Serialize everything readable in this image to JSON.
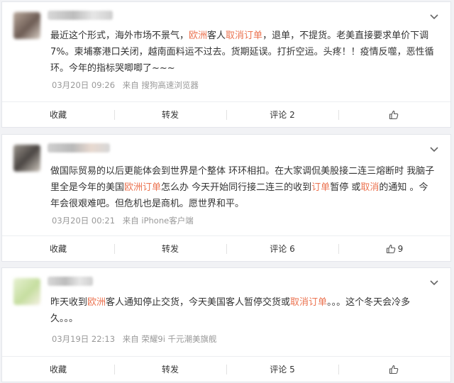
{
  "comments": [
    {
      "segments": [
        {
          "text": "最近这个形式，海外市场不景气，",
          "hl": false
        },
        {
          "text": "欧洲",
          "hl": true
        },
        {
          "text": "客人",
          "hl": false
        },
        {
          "text": "取消订单",
          "hl": true
        },
        {
          "text": "，退单，不提货。老美直接要求单价下调7%。柬埔寨港口关闭，越南面料运不过去。货期延误。打折空运。头疼！！疫情反噬，恶性循环。今年的指标哭唧唧了~~~",
          "hl": false
        }
      ],
      "date": "03月20日 09:26",
      "source": "来自 搜狗高速浏览器",
      "actions": {
        "favorite": "收藏",
        "forward": "转发",
        "comment": "评论 2",
        "like": ""
      }
    },
    {
      "segments": [
        {
          "text": "做国际贸易的以后更能体会到世界是个整体 环环相扣。在大家调侃美股接二连三熔断时 我脑子里全是今年的美国",
          "hl": false
        },
        {
          "text": "欧洲订单",
          "hl": true
        },
        {
          "text": "怎么办 今天开始同行接二连三的收到",
          "hl": false
        },
        {
          "text": "订单",
          "hl": true
        },
        {
          "text": "暂停 或",
          "hl": false
        },
        {
          "text": "取消",
          "hl": true
        },
        {
          "text": "的通知 。今年会很艰难吧。但危机也是商机。愿世界和平。",
          "hl": false
        }
      ],
      "date": "03月20日 00:21",
      "source": "来自 iPhone客户端",
      "actions": {
        "favorite": "收藏",
        "forward": "转发",
        "comment": "评论 6",
        "like": "9"
      }
    },
    {
      "segments": [
        {
          "text": "昨天收到",
          "hl": false
        },
        {
          "text": "欧洲",
          "hl": true
        },
        {
          "text": "客人通知停止交货，今天美国客人暂停交货或",
          "hl": false
        },
        {
          "text": "取消订单",
          "hl": true
        },
        {
          "text": "。。。这个冬天会冷多久。。。",
          "hl": false
        }
      ],
      "date": "03月19日 22:13",
      "source": "来自 荣耀9i 千元潮美旗舰",
      "actions": {
        "favorite": "收藏",
        "forward": "转发",
        "comment": "评论 5",
        "like": ""
      }
    }
  ],
  "colors": {
    "highlight": "#eb7350",
    "meta": "#999999",
    "text": "#333333"
  },
  "icons": {
    "menu": "chevron-down-icon",
    "like": "thumbs-up-icon"
  }
}
